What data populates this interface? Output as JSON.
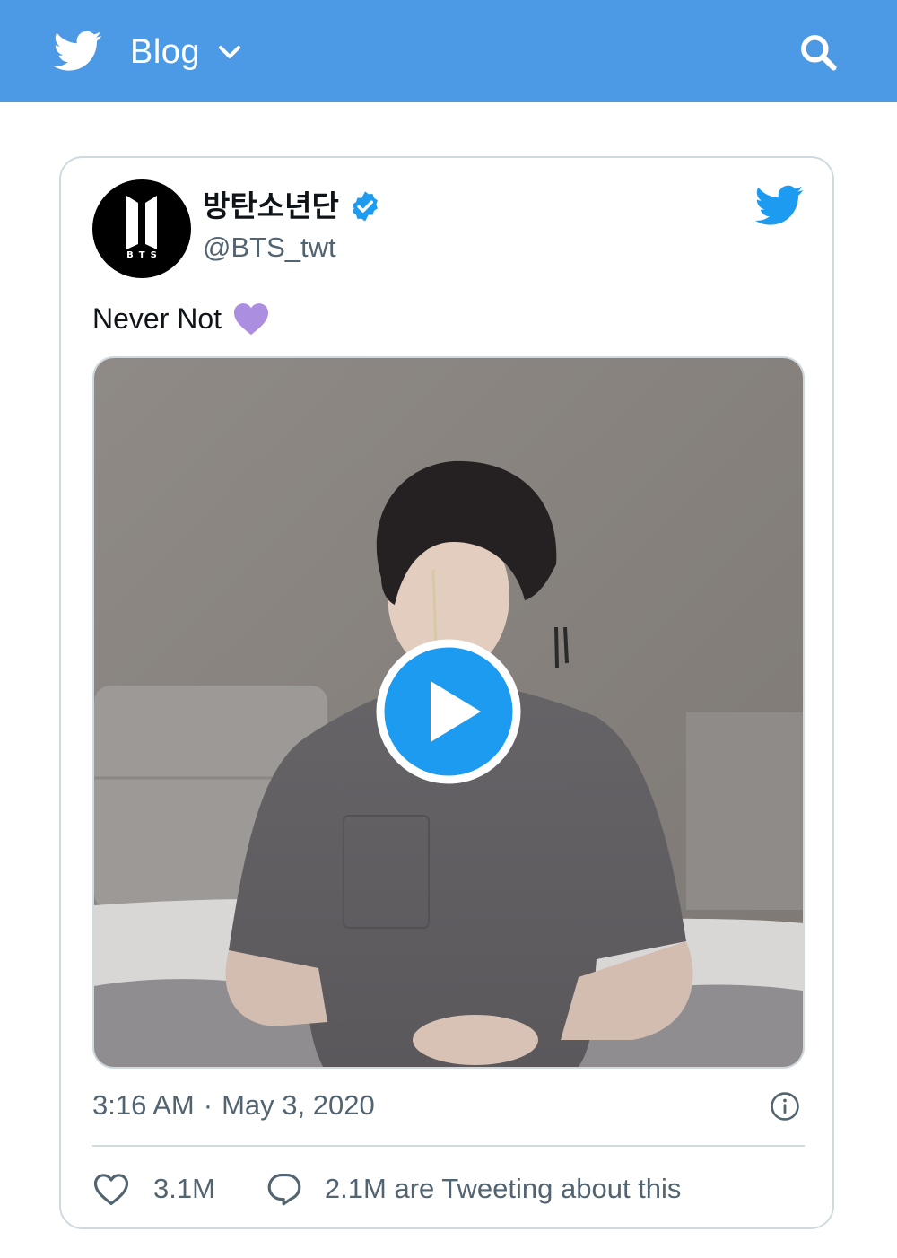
{
  "colors": {
    "header_bg": "#4c9ae6",
    "twitter_blue": "#1d9bf0",
    "secondary_text": "#536471",
    "border": "#cfd9de",
    "purple_heart": "#ac8ee0"
  },
  "header": {
    "logo_icon": "twitter-bird-icon",
    "menu_label": "Blog",
    "menu_icon": "chevron-down-icon",
    "search_icon": "search-icon"
  },
  "tweet": {
    "avatar_text": "BTS",
    "display_name": "방탄소년단",
    "verified_icon": "verified-badge-icon",
    "handle": "@BTS_twt",
    "brand_icon": "twitter-bird-icon",
    "text": "Never Not",
    "text_emoji": "purple-heart-emoji",
    "media": {
      "type": "video",
      "play_icon": "play-icon"
    },
    "time": "3:16 AM",
    "separator": "·",
    "date": "May 3, 2020",
    "info_icon": "info-icon",
    "like_icon": "heart-outline-icon",
    "like_count": "3.1M",
    "reply_icon": "speech-bubble-icon",
    "reply_text": "2.1M are Tweeting about this"
  }
}
